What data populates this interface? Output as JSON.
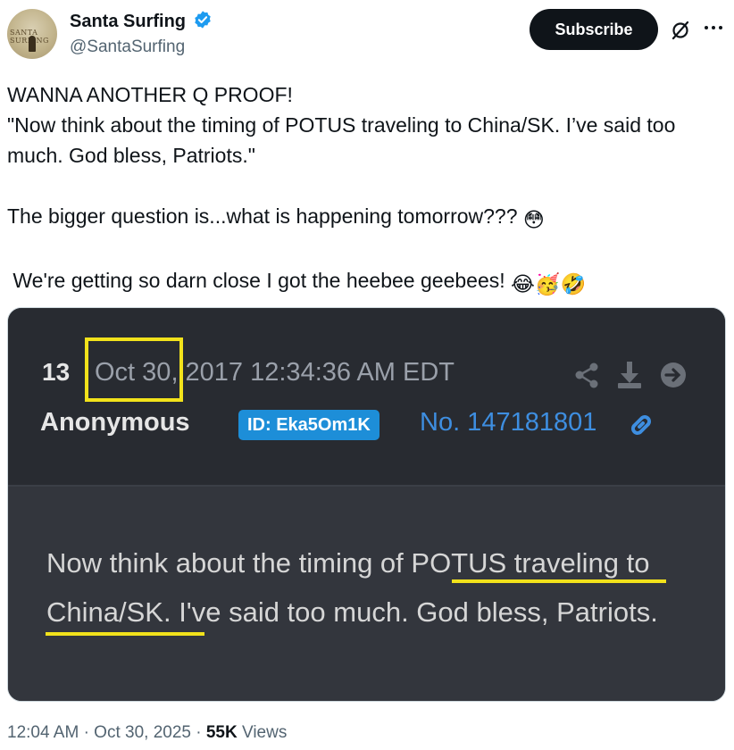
{
  "author": {
    "display_name": "Santa Surfing",
    "handle": "@SantaSurfing",
    "avatar_text": "SANTA SURFING",
    "verified_color": "#1d9bf0"
  },
  "actions": {
    "subscribe_label": "Subscribe",
    "grok_icon": "grok-icon",
    "more_icon": "more-dots-icon"
  },
  "tweet": {
    "line1": "WANNA ANOTHER Q PROOF!",
    "line2": "\"Now think about the timing of POTUS traveling to China/SK. I’ve said too much. God bless, Patriots.\"",
    "line3": "The bigger question is...what is happening tomorrow???",
    "line3_emoji": "😳",
    "line4": " We're getting so darn close I got the heebee geebees!",
    "line4_emoji": "😂🥳🤣"
  },
  "media": {
    "post_number": "13",
    "post_date_highlighted": "Oct 30",
    "post_date_rest": ", 2017 12:34:36 AM EDT",
    "poster_name": "Anonymous",
    "poster_id": "ID: Eka5Om1K",
    "post_no": "No. 147181801",
    "body": "Now think about the timing of POTUS traveling to China/SK. I've said too much. God bless, Patriots.",
    "highlight_color": "#f2e21b",
    "icons": [
      "share-icon",
      "download-icon",
      "arrow-right-icon",
      "link-icon"
    ]
  },
  "meta": {
    "time": "12:04 AM",
    "date": "Oct 30, 2025",
    "views_count": "55K",
    "views_label": "Views",
    "separator": "·"
  }
}
